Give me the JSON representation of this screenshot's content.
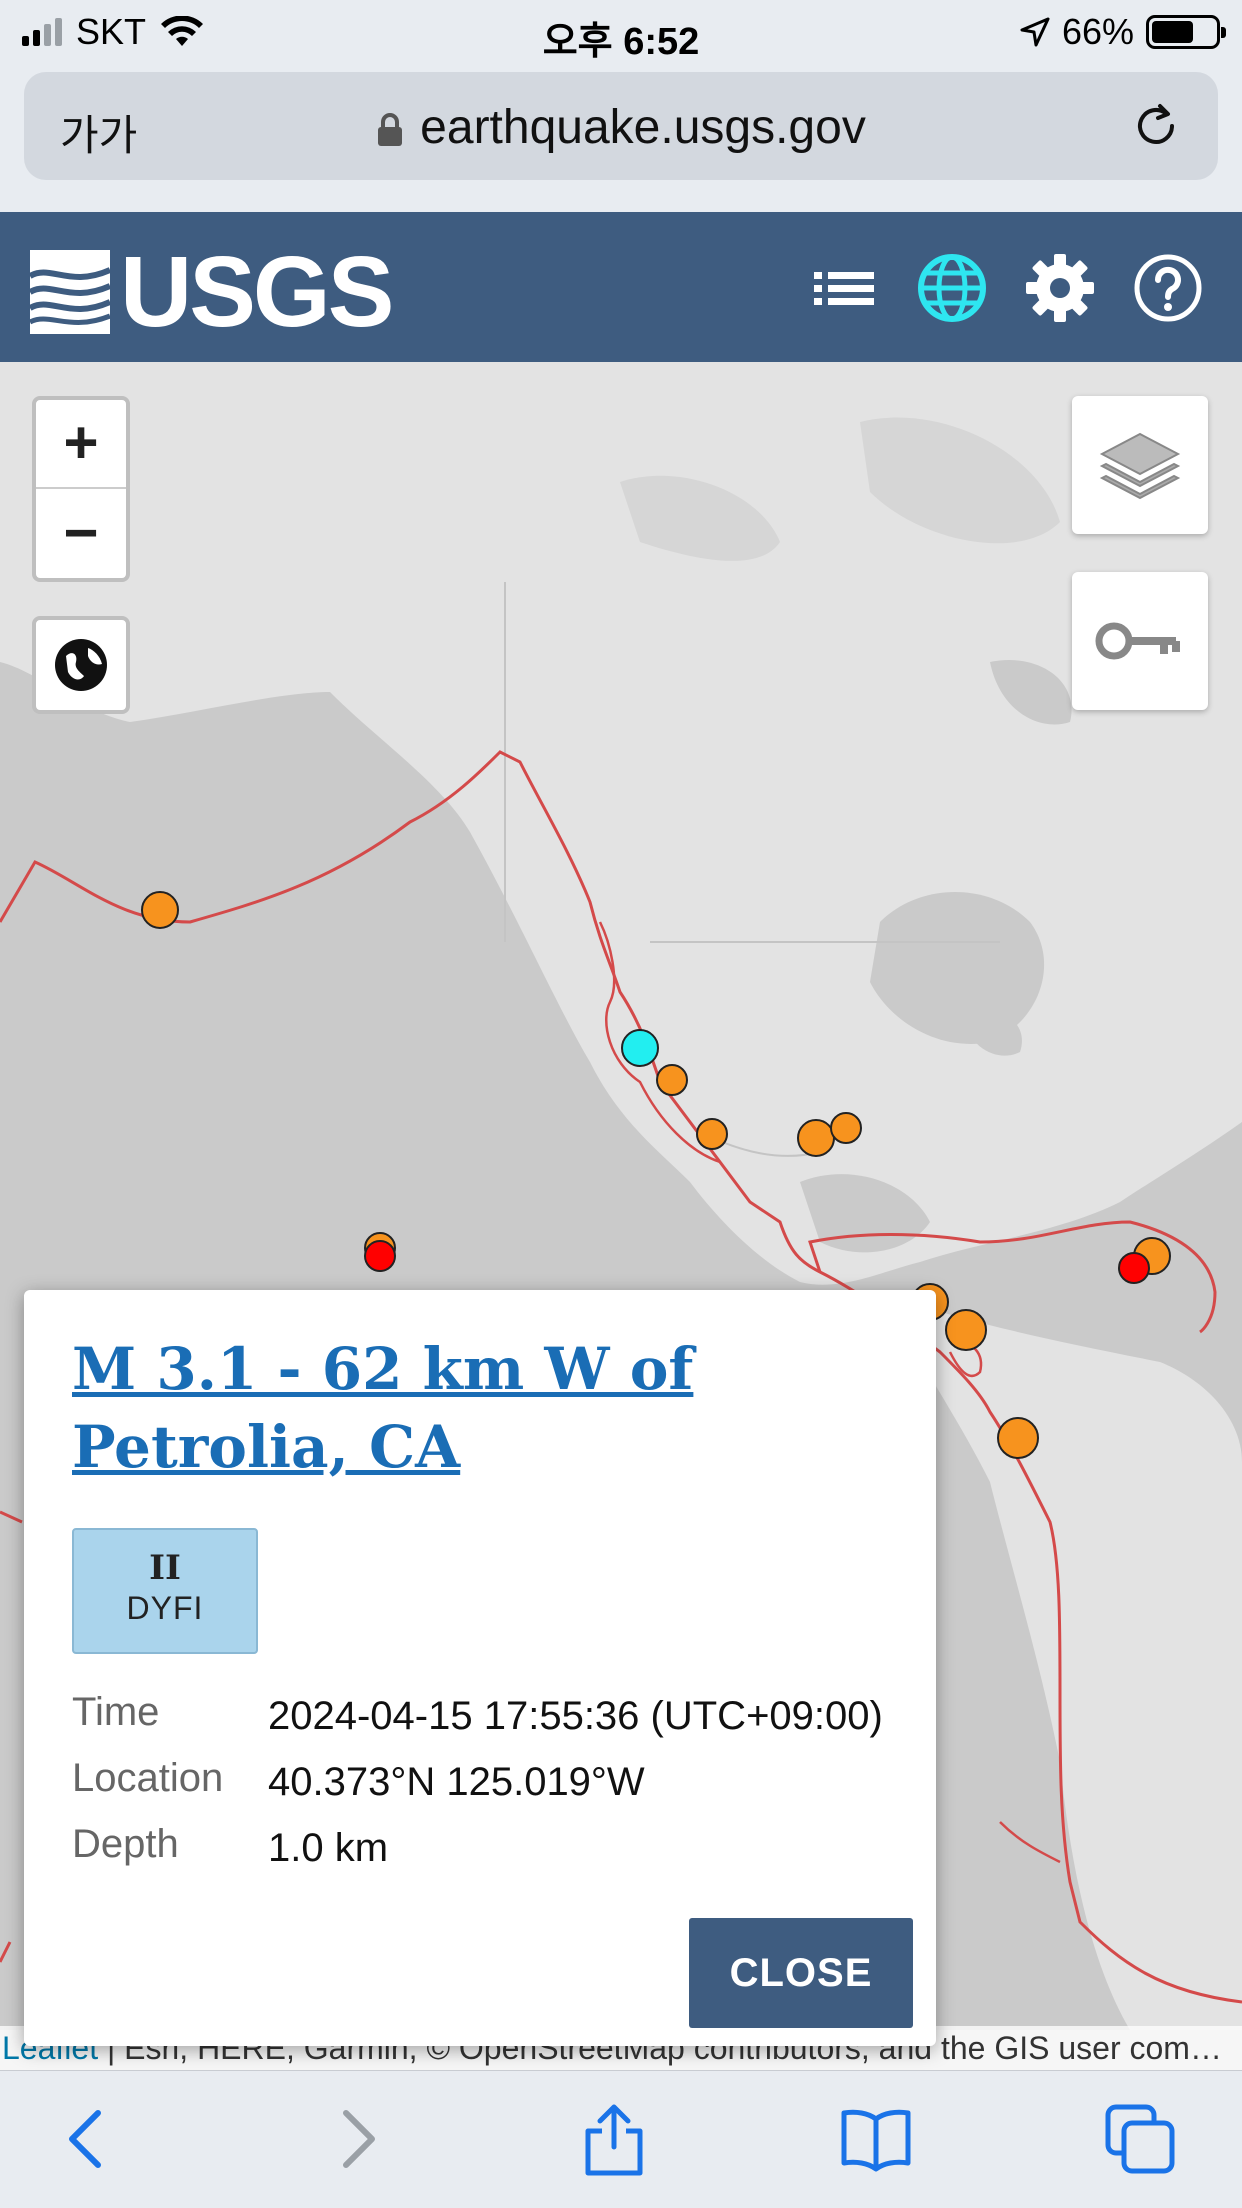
{
  "status_bar": {
    "carrier": "SKT",
    "time": "오후 6:52",
    "battery": "66%",
    "battery_level": 0.66
  },
  "browser": {
    "text_size_label": "가가",
    "url": "earthquake.usgs.gov"
  },
  "header": {
    "logo_text": "USGS",
    "icons": [
      "list-icon",
      "globe-icon",
      "gear-icon",
      "help-icon"
    ],
    "active_icon": "globe-icon",
    "bg_color": "#3e5c80",
    "active_color": "#2ee6f0"
  },
  "map": {
    "zoom_in_label": "+",
    "zoom_out_label": "−",
    "attribution_link": "Leaflet",
    "attribution_text": " | Esri, HERE, Garmin, © OpenStreetMap contributors, and the GIS user comm..."
  },
  "popup": {
    "title": "M 3.1 - 62 km W of Petrolia, CA",
    "dyfi_intensity": "II",
    "dyfi_label": "DYFI",
    "details": [
      {
        "key": "Time",
        "value": "2024-04-15 17:55:36 (UTC+09:00)"
      },
      {
        "key": "Location",
        "value": "40.373°N 125.019°W"
      },
      {
        "key": "Depth",
        "value": "1.0 km"
      }
    ],
    "close_label": "CLOSE"
  },
  "marker_colors": {
    "orange": "#f7931e",
    "red": "#ff0000",
    "cyan": "#22eef0"
  },
  "toolbar": {
    "icons": [
      "back-icon",
      "forward-icon",
      "share-icon",
      "bookmarks-icon",
      "tabs-icon"
    ]
  }
}
